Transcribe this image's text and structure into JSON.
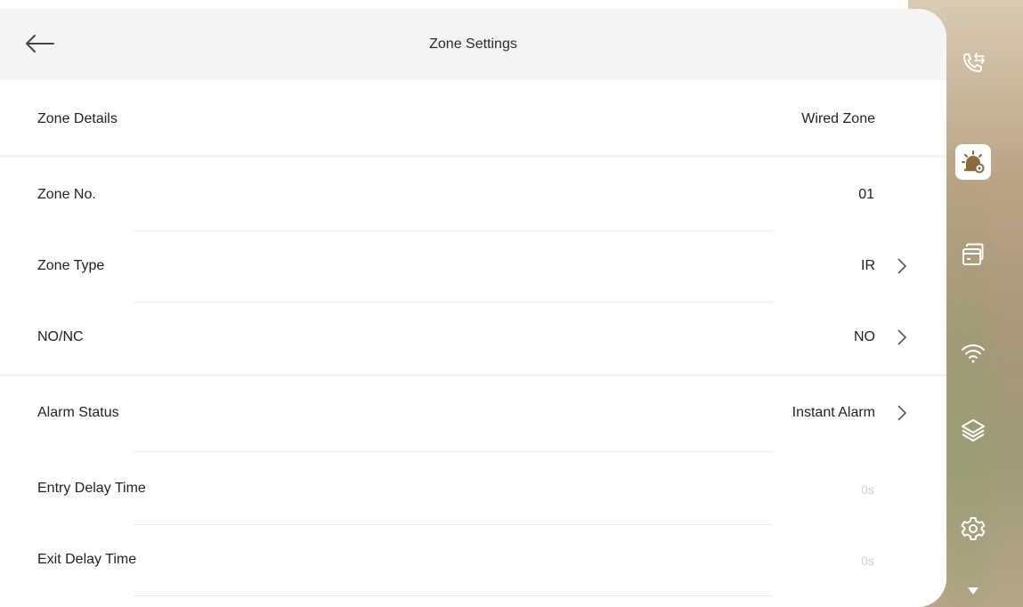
{
  "header": {
    "title": "Zone Settings"
  },
  "rows": [
    {
      "label": "Zone Details",
      "value": "Wired Zone"
    },
    {
      "label": "Zone No.",
      "value": "01"
    },
    {
      "label": "Zone Type",
      "value": "IR"
    },
    {
      "label": "NO/NC",
      "value": "NO"
    },
    {
      "label": "Alarm Status",
      "value": "Instant Alarm"
    },
    {
      "label": "Entry Delay Time",
      "value": "0s"
    },
    {
      "label": "Exit Delay Time",
      "value": "0s"
    }
  ],
  "sidebar": {
    "items": [
      {
        "icon": "call-log-icon"
      },
      {
        "icon": "alarm-settings-icon",
        "active": true
      },
      {
        "icon": "cards-icon"
      },
      {
        "icon": "wifi-icon"
      },
      {
        "icon": "layers-icon"
      },
      {
        "icon": "gear-icon"
      },
      {
        "icon": "scroll-down-icon"
      }
    ]
  },
  "colors": {
    "accent": "#8a6a3a",
    "sidebar_icon": "#ffffff"
  }
}
